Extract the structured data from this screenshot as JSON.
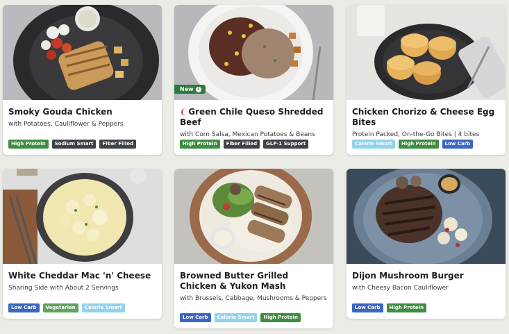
{
  "meals": [
    {
      "title": "Smoky Gouda Chicken",
      "subtitle": "with Potatoes, Cauliflower & Peppers",
      "badges": [
        {
          "label": "High Protein",
          "color": "#3e8e41"
        },
        {
          "label": "Sodium Smart",
          "color": "#3f4347"
        },
        {
          "label": "Fiber Filled",
          "color": "#3f4347"
        }
      ]
    },
    {
      "title": "Green Chile Queso Shredded Beef",
      "subtitle": "with Corn Salsa, Mexican Potatoes & Beans",
      "new_label": "New",
      "badges": [
        {
          "label": "High Protein",
          "color": "#3e8e41"
        },
        {
          "label": "Fiber Filled",
          "color": "#3f4347"
        },
        {
          "label": "GLP-1 Support",
          "color": "#3f4347"
        }
      ]
    },
    {
      "title": "Chicken Chorizo & Cheese Egg Bites",
      "subtitle": "Protein Packed, On-the-Go Bites | 4 bites",
      "badges": [
        {
          "label": "Calorie Smart",
          "color": "#8fd3f0"
        },
        {
          "label": "High Protein",
          "color": "#3e8e41"
        },
        {
          "label": "Low Carb",
          "color": "#3b67c4"
        }
      ]
    },
    {
      "title": "White Cheddar Mac 'n' Cheese",
      "subtitle": "Sharing Side with About 2 Servings",
      "badges": [
        {
          "label": "Low Carb",
          "color": "#3b67c4"
        },
        {
          "label": "Vegetarian",
          "color": "#5da35f"
        },
        {
          "label": "Calorie Smart",
          "color": "#8fd3f0"
        }
      ]
    },
    {
      "title": "Browned Butter Grilled Chicken & Yukon Mash",
      "subtitle": "with Brussels, Cabbage, Mushrooms & Peppers",
      "badges": [
        {
          "label": "Low Carb",
          "color": "#3b67c4"
        },
        {
          "label": "Calorie Smart",
          "color": "#8fd3f0"
        },
        {
          "label": "High Protein",
          "color": "#3e8e41"
        }
      ]
    },
    {
      "title": "Dijon Mushroom Burger",
      "subtitle": "with Cheesy Bacon Cauliflower",
      "badges": [
        {
          "label": "Low Carb",
          "color": "#3b67c4"
        },
        {
          "label": "High Protein",
          "color": "#3e8e41"
        }
      ]
    }
  ]
}
